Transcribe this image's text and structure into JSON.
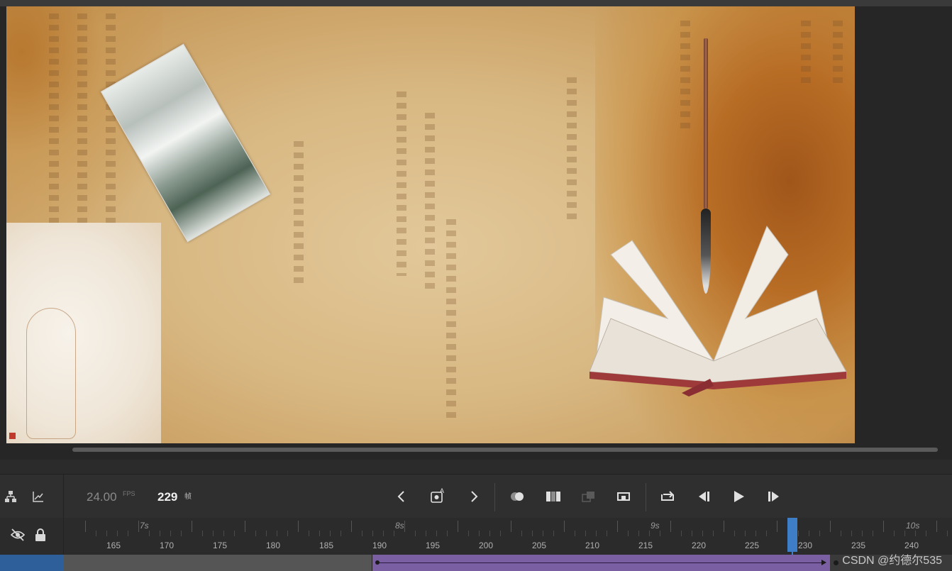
{
  "timeline": {
    "fps_value": "24.00",
    "fps_unit": "FPS",
    "current_frame": "229",
    "frame_unit": "帧",
    "seconds_labels": [
      {
        "label": "7s"
      },
      {
        "label": "8s"
      },
      {
        "label": "9s"
      },
      {
        "label": "10s"
      }
    ],
    "frame_labels": [
      "165",
      "170",
      "175",
      "180",
      "185",
      "190",
      "195",
      "200",
      "205",
      "210",
      "215",
      "220",
      "225",
      "230",
      "235",
      "240"
    ],
    "icons": {
      "layer_hierarchy": "layer-hierarchy-icon",
      "graph": "graph-icon",
      "visibility": "eye-off-icon",
      "lock": "lock-icon",
      "prev_keyframe": "chevron-left-icon",
      "insert_keyframe": "insert-keyframe-icon",
      "next_keyframe": "chevron-right-icon",
      "onion_skin": "onion-skin-icon",
      "edit_multiple": "edit-multiple-frames-icon",
      "center_frame": "center-frame-icon",
      "loop": "loop-icon",
      "step_back": "step-back-icon",
      "play": "play-icon",
      "step_forward": "step-forward-icon"
    },
    "colors": {
      "playhead": "#3d7ec6",
      "tween": "#7a5fa3",
      "layer": "#2e5f9a"
    }
  },
  "watermark": "CSDN @约德尔535"
}
